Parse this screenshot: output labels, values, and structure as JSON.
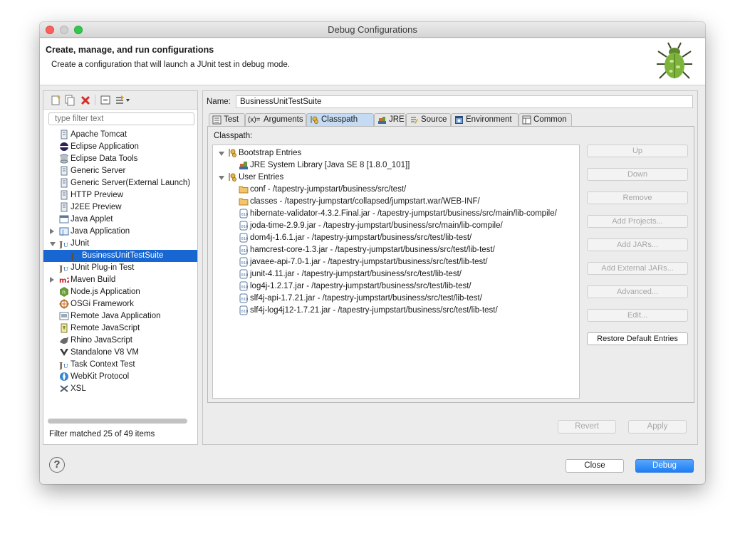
{
  "window": {
    "title": "Debug Configurations"
  },
  "banner": {
    "heading": "Create, manage, and run configurations",
    "description": "Create a configuration that will launch a JUnit test in debug mode."
  },
  "left": {
    "filter_placeholder": "type filter text",
    "tree": [
      {
        "label": "Apache Tomcat",
        "icon": "server-icon"
      },
      {
        "label": "Eclipse Application",
        "icon": "eclipse-icon"
      },
      {
        "label": "Eclipse Data Tools",
        "icon": "database-icon"
      },
      {
        "label": "Generic Server",
        "icon": "server-icon"
      },
      {
        "label": "Generic Server(External Launch)",
        "icon": "server-icon"
      },
      {
        "label": "HTTP Preview",
        "icon": "server-icon"
      },
      {
        "label": "J2EE Preview",
        "icon": "server-icon"
      },
      {
        "label": "Java Applet",
        "icon": "applet-icon"
      },
      {
        "label": "Java Application",
        "icon": "java-app-icon"
      },
      {
        "label": "JUnit",
        "icon": "junit-icon"
      },
      {
        "label": "BusinessUnitTestSuite",
        "icon": "junit-icon"
      },
      {
        "label": "JUnit Plug-in Test",
        "icon": "junit-icon"
      },
      {
        "label": "Maven Build",
        "icon": "maven-icon"
      },
      {
        "label": "Node.js Application",
        "icon": "nodejs-icon"
      },
      {
        "label": "OSGi Framework",
        "icon": "osgi-icon"
      },
      {
        "label": "Remote Java Application",
        "icon": "remote-java-icon"
      },
      {
        "label": "Remote JavaScript",
        "icon": "remote-js-icon"
      },
      {
        "label": "Rhino JavaScript",
        "icon": "rhino-icon"
      },
      {
        "label": "Standalone V8 VM",
        "icon": "v8-icon"
      },
      {
        "label": "Task Context Test",
        "icon": "junit-icon"
      },
      {
        "label": "WebKit Protocol",
        "icon": "webkit-icon"
      },
      {
        "label": "XSL",
        "icon": "xsl-icon"
      }
    ],
    "filter_status": "Filter matched 25 of 49 items"
  },
  "right": {
    "name_label": "Name:",
    "name_value": "BusinessUnitTestSuite",
    "tabs": [
      {
        "label": "Test",
        "icon": "test-icon"
      },
      {
        "label": "Arguments",
        "icon": "arguments-icon"
      },
      {
        "label": "Classpath",
        "icon": "classpath-icon"
      },
      {
        "label": "JRE",
        "icon": "jre-icon"
      },
      {
        "label": "Source",
        "icon": "source-icon"
      },
      {
        "label": "Environment",
        "icon": "environment-icon"
      },
      {
        "label": "Common",
        "icon": "common-icon"
      }
    ],
    "classpath_label": "Classpath:",
    "classpath": [
      {
        "label": "Bootstrap Entries",
        "icon": "entries-icon"
      },
      {
        "label": "JRE System Library [Java SE 8 [1.8.0_101]]",
        "icon": "library-icon"
      },
      {
        "label": "User Entries",
        "icon": "entries-icon"
      },
      {
        "label": "conf - /tapestry-jumpstart/business/src/test/",
        "icon": "folder-icon"
      },
      {
        "label": "classes - /tapestry-jumpstart/collapsed/jumpstart.war/WEB-INF/",
        "icon": "folder-icon"
      },
      {
        "label": "hibernate-validator-4.3.2.Final.jar - /tapestry-jumpstart/business/src/main/lib-compile/",
        "icon": "jar-icon"
      },
      {
        "label": "joda-time-2.9.9.jar - /tapestry-jumpstart/business/src/main/lib-compile/",
        "icon": "jar-icon"
      },
      {
        "label": "dom4j-1.6.1.jar - /tapestry-jumpstart/business/src/test/lib-test/",
        "icon": "jar-icon"
      },
      {
        "label": "hamcrest-core-1.3.jar - /tapestry-jumpstart/business/src/test/lib-test/",
        "icon": "jar-icon"
      },
      {
        "label": "javaee-api-7.0-1.jar - /tapestry-jumpstart/business/src/test/lib-test/",
        "icon": "jar-icon"
      },
      {
        "label": "junit-4.11.jar - /tapestry-jumpstart/business/src/test/lib-test/",
        "icon": "jar-icon"
      },
      {
        "label": "log4j-1.2.17.jar - /tapestry-jumpstart/business/src/test/lib-test/",
        "icon": "jar-icon"
      },
      {
        "label": "slf4j-api-1.7.21.jar - /tapestry-jumpstart/business/src/test/lib-test/",
        "icon": "jar-icon"
      },
      {
        "label": "slf4j-log4j12-1.7.21.jar - /tapestry-jumpstart/business/src/test/lib-test/",
        "icon": "jar-icon"
      }
    ],
    "side_buttons": {
      "up": "Up",
      "down": "Down",
      "remove": "Remove",
      "add_projects": "Add Projects...",
      "add_jars": "Add JARs...",
      "add_external_jars": "Add External JARs...",
      "advanced": "Advanced...",
      "edit": "Edit...",
      "restore_default": "Restore Default Entries"
    },
    "revert": "Revert",
    "apply": "Apply"
  },
  "footer": {
    "help": "?",
    "close": "Close",
    "debug": "Debug"
  },
  "colors": {
    "selection": "#1766d1",
    "primary_button": "#1d7ef6"
  }
}
